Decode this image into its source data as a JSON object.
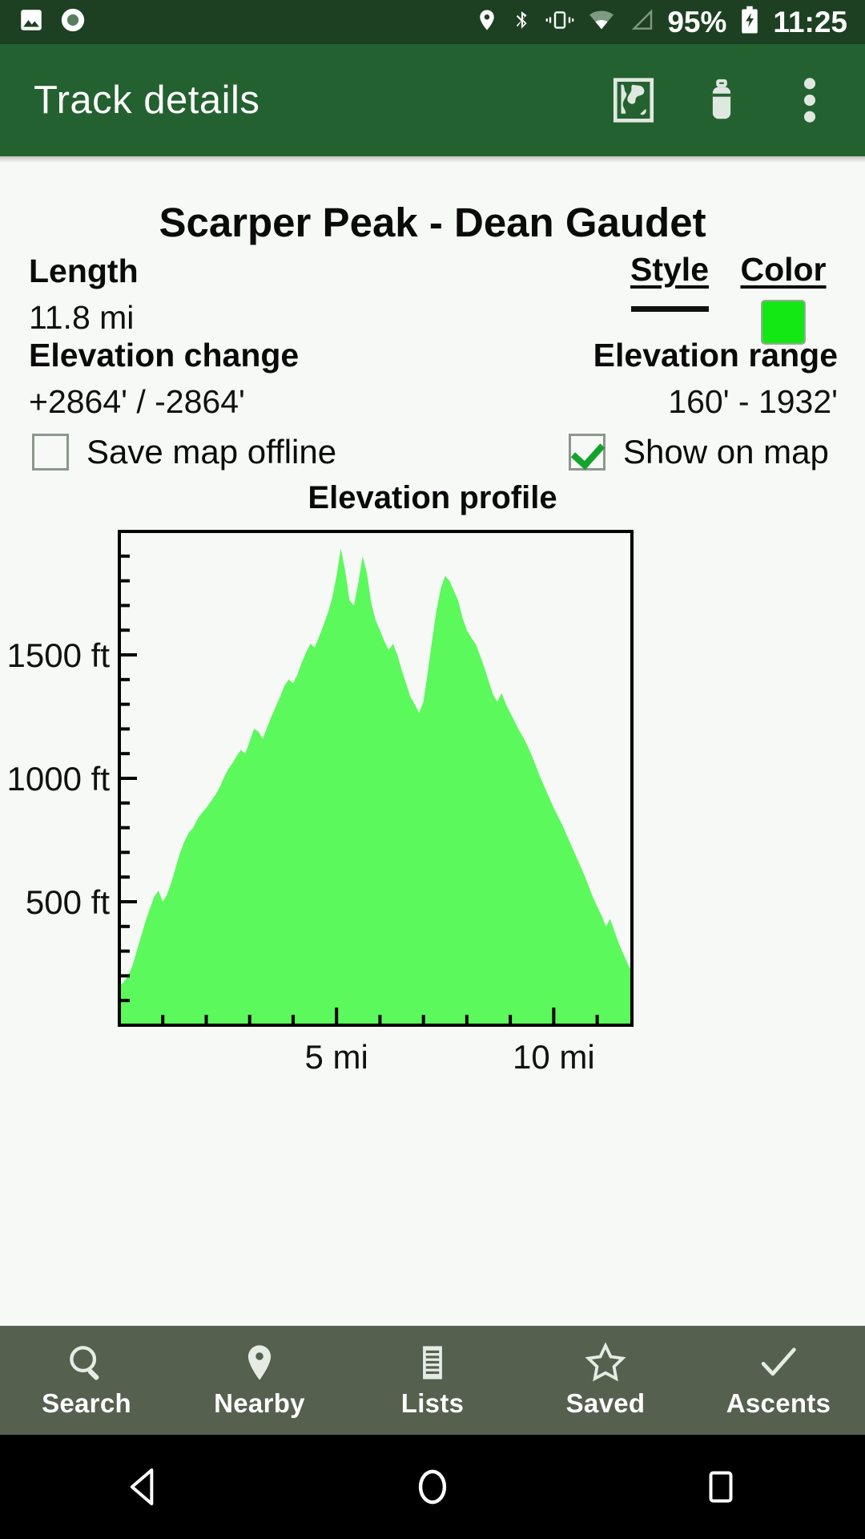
{
  "status_bar": {
    "battery_percent": "95%",
    "time": "11:25",
    "icons": [
      "image-icon",
      "record-icon",
      "location-pin-icon",
      "bluetooth-icon",
      "vibrate-icon",
      "wifi-icon",
      "cell-signal-icon",
      "battery-charging-icon"
    ]
  },
  "app_bar": {
    "title": "Track details",
    "actions": [
      "map-icon",
      "trash-icon",
      "overflow-menu-icon"
    ]
  },
  "track": {
    "title": "Scarper Peak - Dean Gaudet",
    "length_label": "Length",
    "length_value": "11.8 mi",
    "style_label": "Style",
    "color_label": "Color",
    "color_value": "#14e814",
    "elevation_change_label": "Elevation change",
    "elevation_change_value": "+2864' / -2864'",
    "elevation_range_label": "Elevation range",
    "elevation_range_value": "160' - 1932'"
  },
  "checkboxes": [
    {
      "label": "Save map offline",
      "checked": false
    },
    {
      "label": "Show on map",
      "checked": true
    }
  ],
  "chart_data": {
    "type": "area",
    "title": "Elevation profile",
    "xlabel": "",
    "ylabel": "",
    "xlim": [
      0,
      11.8
    ],
    "ylim": [
      0,
      2000
    ],
    "x_tick_labels": [
      "5 mi",
      "10 mi"
    ],
    "x_tick_values": [
      5,
      10
    ],
    "x_minor_step": 1,
    "y_tick_labels": [
      "500 ft",
      "1000 ft",
      "1500 ft"
    ],
    "y_tick_values": [
      500,
      1000,
      1500
    ],
    "y_minor_step": 100,
    "grid": false,
    "legend": null,
    "fill_color": "#5cf95c",
    "x_units": "mi",
    "y_units": "ft",
    "series": [
      {
        "name": "Elevation",
        "x": [
          0.0,
          0.1,
          0.2,
          0.3,
          0.4,
          0.5,
          0.6,
          0.7,
          0.8,
          0.9,
          1.0,
          1.1,
          1.2,
          1.3,
          1.4,
          1.5,
          1.6,
          1.7,
          1.8,
          1.9,
          2.0,
          2.1,
          2.2,
          2.3,
          2.4,
          2.5,
          2.6,
          2.7,
          2.8,
          2.9,
          3.0,
          3.1,
          3.2,
          3.3,
          3.4,
          3.5,
          3.6,
          3.7,
          3.8,
          3.9,
          4.0,
          4.1,
          4.2,
          4.3,
          4.4,
          4.5,
          4.6,
          4.7,
          4.8,
          4.9,
          5.0,
          5.1,
          5.2,
          5.3,
          5.4,
          5.5,
          5.6,
          5.7,
          5.8,
          5.9,
          6.0,
          6.1,
          6.2,
          6.3,
          6.4,
          6.5,
          6.6,
          6.7,
          6.8,
          6.9,
          7.0,
          7.1,
          7.2,
          7.3,
          7.4,
          7.5,
          7.6,
          7.7,
          7.8,
          7.9,
          8.0,
          8.1,
          8.2,
          8.3,
          8.4,
          8.5,
          8.6,
          8.7,
          8.8,
          8.9,
          9.0,
          9.1,
          9.2,
          9.3,
          9.4,
          9.5,
          9.6,
          9.7,
          9.8,
          9.9,
          10.0,
          10.1,
          10.2,
          10.3,
          10.4,
          10.5,
          10.6,
          10.7,
          10.8,
          10.9,
          11.0,
          11.1,
          11.2,
          11.3,
          11.4,
          11.5,
          11.6,
          11.7,
          11.8
        ],
        "y": [
          160,
          175,
          200,
          240,
          300,
          360,
          420,
          470,
          520,
          545,
          500,
          530,
          580,
          640,
          700,
          745,
          780,
          800,
          835,
          860,
          880,
          905,
          930,
          960,
          1000,
          1035,
          1060,
          1090,
          1115,
          1100,
          1150,
          1200,
          1190,
          1160,
          1205,
          1250,
          1290,
          1330,
          1375,
          1400,
          1385,
          1420,
          1470,
          1510,
          1545,
          1530,
          1575,
          1620,
          1670,
          1730,
          1820,
          1932,
          1840,
          1720,
          1700,
          1790,
          1900,
          1830,
          1710,
          1640,
          1600,
          1555,
          1520,
          1545,
          1500,
          1440,
          1385,
          1330,
          1300,
          1265,
          1310,
          1430,
          1560,
          1680,
          1770,
          1820,
          1800,
          1760,
          1720,
          1650,
          1600,
          1570,
          1545,
          1500,
          1450,
          1395,
          1340,
          1310,
          1345,
          1300,
          1265,
          1230,
          1195,
          1165,
          1130,
          1090,
          1045,
          1000,
          960,
          920,
          880,
          845,
          810,
          770,
          730,
          690,
          650,
          610,
          565,
          520,
          480,
          445,
          400,
          430,
          380,
          330,
          290,
          250,
          215
        ]
      }
    ]
  },
  "bottom_nav": [
    {
      "label": "Search",
      "icon": "search-icon"
    },
    {
      "label": "Nearby",
      "icon": "map-pin-icon"
    },
    {
      "label": "Lists",
      "icon": "list-icon"
    },
    {
      "label": "Saved",
      "icon": "star-icon"
    },
    {
      "label": "Ascents",
      "icon": "check-icon"
    }
  ],
  "android_nav": [
    {
      "name": "back-button",
      "icon": "triangle-back-icon"
    },
    {
      "name": "home-button",
      "icon": "circle-home-icon"
    },
    {
      "name": "recents-button",
      "icon": "square-recents-icon"
    }
  ]
}
